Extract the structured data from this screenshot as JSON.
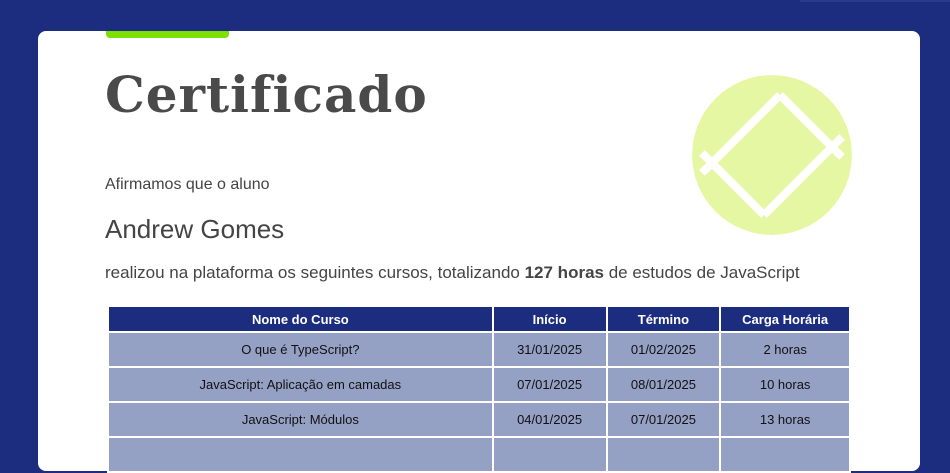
{
  "certificate": {
    "title": "Certificado",
    "intro": "Afirmamos que o aluno",
    "student_name": "Andrew Gomes",
    "summary_prefix": "realizou na plataforma os seguintes cursos, totalizando",
    "total_hours": "127 horas",
    "summary_suffix": "de estudos de JavaScript"
  },
  "table": {
    "headers": [
      "Nome do Curso",
      "Início",
      "Término",
      "Carga Horária"
    ],
    "rows": [
      [
        "O que é TypeScript?",
        "31/01/2025",
        "01/02/2025",
        "2 horas"
      ],
      [
        "JavaScript: Aplicação em camadas",
        "07/01/2025",
        "08/01/2025",
        "10 horas"
      ],
      [
        "JavaScript: Módulos",
        "04/01/2025",
        "07/01/2025",
        "13 horas"
      ],
      [
        "",
        "",
        "",
        ""
      ]
    ]
  },
  "colors": {
    "background": "#1c2d80",
    "accent": "#7ce000",
    "logo": "#e6f7a3",
    "header_row": "#1c2d80",
    "body_row": "#95a0c5"
  },
  "icons": {
    "logo": "logo-icon"
  }
}
